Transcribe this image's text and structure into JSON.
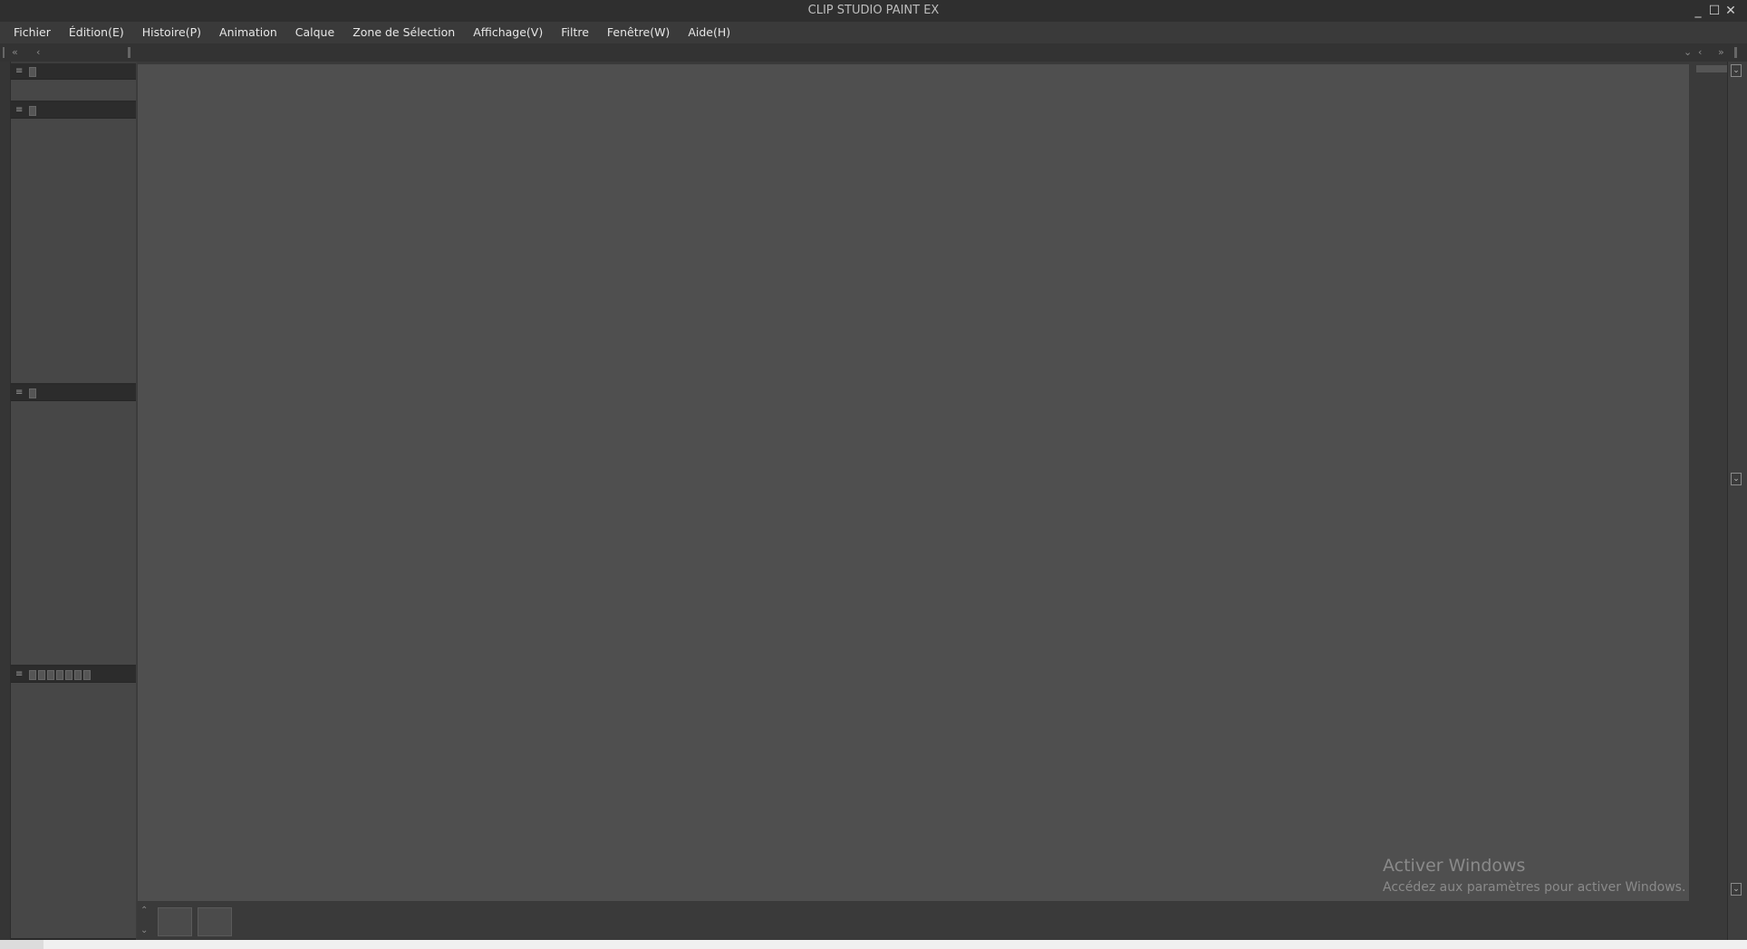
{
  "window": {
    "title": "CLIP STUDIO PAINT EX",
    "minimize_glyph": "_",
    "maximize_glyph": "☐",
    "close_glyph": "✕"
  },
  "menubar": {
    "items": [
      "Fichier",
      "Édition(E)",
      "Histoire(P)",
      "Animation",
      "Calque",
      "Zone de Sélection",
      "Affichage(V)",
      "Filtre",
      "Fenêtre(W)",
      "Aide(H)"
    ]
  },
  "cmdbar": {
    "left_collapse": "«",
    "left_arrow": "‹",
    "right_dropdown": "⌄",
    "right_arrow": "‹",
    "right_collapse": "»"
  },
  "panels": {
    "menu_glyph": "≡"
  },
  "watermark": {
    "title": "Activer Windows",
    "subtitle": "Accédez aux paramètres pour activer Windows."
  },
  "canvas_nav": {
    "up_glyph": "⌃",
    "down_glyph": "⌄"
  },
  "colors": {
    "canvas": "#4f4f4f",
    "chrome": "#3a3a3a",
    "titlebar": "#2f2f2f"
  }
}
